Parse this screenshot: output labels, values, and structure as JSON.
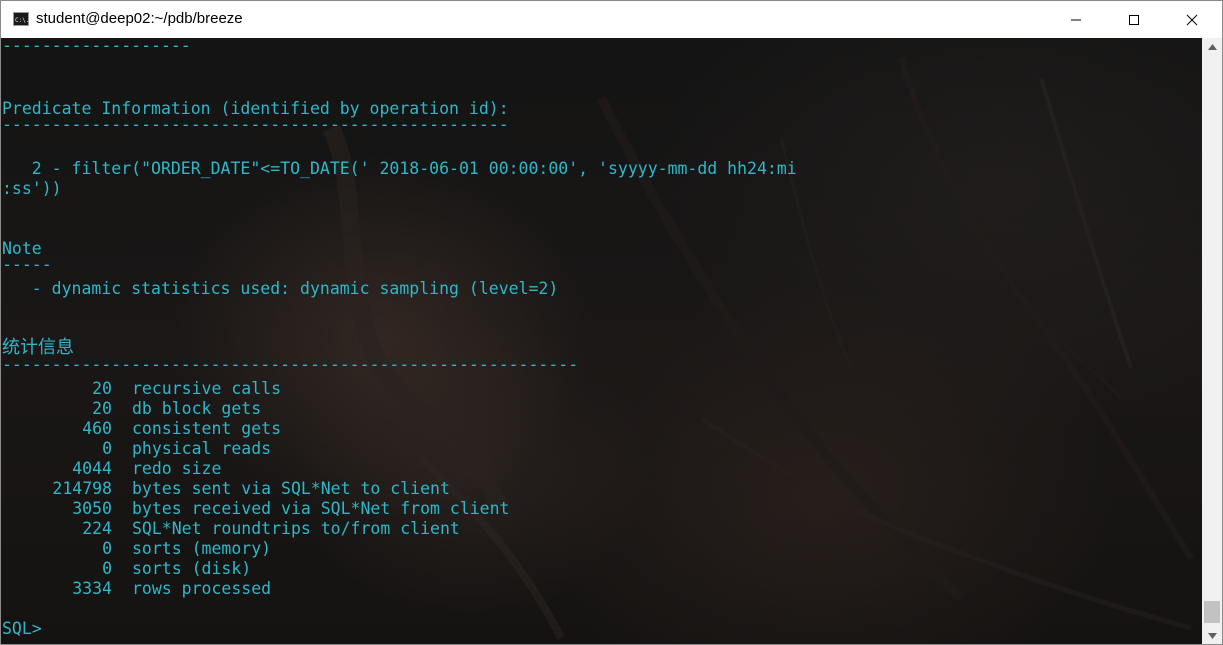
{
  "window": {
    "title": "student@deep02:~/pdb/breeze",
    "app_icon_text": "C:\\."
  },
  "terminal": {
    "text_color": "#2fb7c9",
    "top_rule": "-------------------",
    "predicate_header": "Predicate Information (identified by operation id):",
    "predicate_rule": "---------------------------------------------------",
    "filter_line_1": "   2 - filter(\"ORDER_DATE\"<=TO_DATE(' 2018-06-01 00:00:00', 'syyyy-mm-dd hh24:mi",
    "filter_line_2": ":ss'))",
    "note_header": "Note",
    "note_rule": "-----",
    "note_line": "   - dynamic statistics used: dynamic sampling (level=2)",
    "stats_header": "统计信息",
    "stats_rule": "----------------------------------------------------------",
    "stats": [
      {
        "value": "20",
        "label": "recursive calls"
      },
      {
        "value": "20",
        "label": "db block gets"
      },
      {
        "value": "460",
        "label": "consistent gets"
      },
      {
        "value": "0",
        "label": "physical reads"
      },
      {
        "value": "4044",
        "label": "redo size"
      },
      {
        "value": "214798",
        "label": "bytes sent via SQL*Net to client"
      },
      {
        "value": "3050",
        "label": "bytes received via SQL*Net from client"
      },
      {
        "value": "224",
        "label": "SQL*Net roundtrips to/from client"
      },
      {
        "value": "0",
        "label": "sorts (memory)"
      },
      {
        "value": "0",
        "label": "sorts (disk)"
      },
      {
        "value": "3334",
        "label": "rows processed"
      }
    ],
    "prompt": "SQL>"
  },
  "icons": {
    "minimize": "minimize-icon",
    "maximize": "maximize-icon",
    "close": "close-icon",
    "scroll_up": "scroll-up-arrow-icon",
    "scroll_down": "scroll-down-arrow-icon"
  }
}
